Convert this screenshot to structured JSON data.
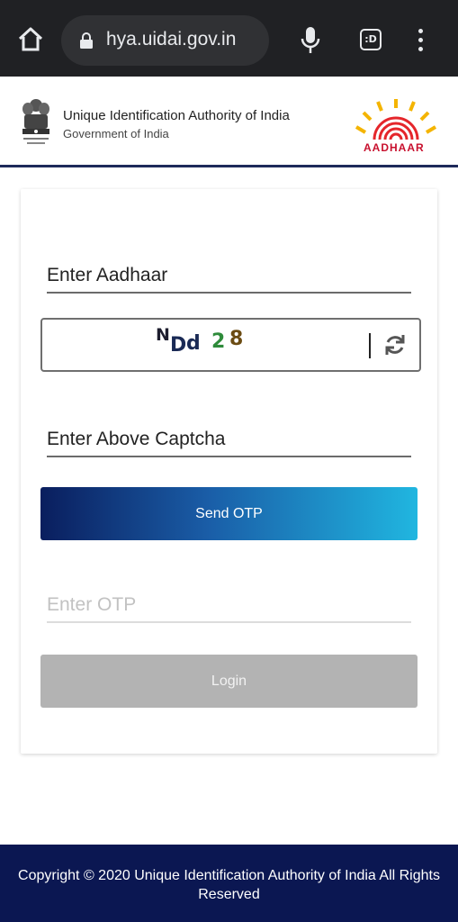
{
  "browser": {
    "url": "hya.uidai.gov.in",
    "tab_indicator": ":D",
    "icons": [
      "home-icon",
      "lock-icon",
      "mic-icon",
      "tabs-icon",
      "menu-icon"
    ]
  },
  "header": {
    "org_name": "Unique Identification Authority of India",
    "org_sub": "Government of India",
    "logo_text": "AADHAAR",
    "colors": {
      "header_border": "#1e2a5a",
      "logo_red": "#c8102e"
    }
  },
  "form": {
    "aadhaar_label": "Enter Aadhaar",
    "captcha": {
      "chars": [
        "N",
        "D",
        "d",
        "2",
        "8"
      ]
    },
    "captcha_label": "Enter Above Captcha",
    "send_otp_label": "Send OTP",
    "otp_label": "Enter OTP",
    "login_label": "Login",
    "colors": {
      "send_gradient_start": "#0a1e5e",
      "send_gradient_end": "#20b6e0",
      "login_disabled": "#b3b3b3"
    }
  },
  "footer": {
    "text": "Copyright © 2020 Unique Identification Authority of India All Rights Reserved",
    "colors": {
      "background": "#0b1752"
    }
  }
}
